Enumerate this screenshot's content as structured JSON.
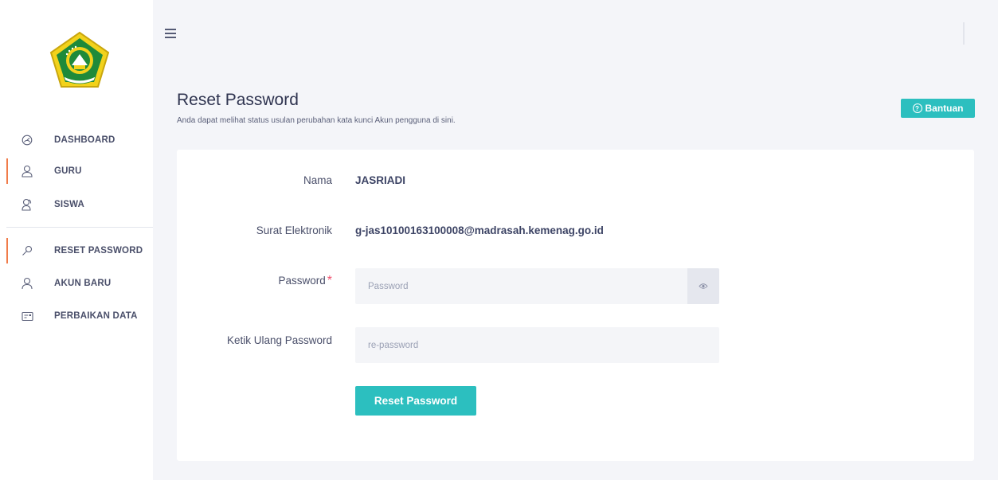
{
  "sidebar": {
    "logo_icon": "kemenag-emblem-icon",
    "items": [
      {
        "label": "DASHBOARD",
        "icon": "dashboard-gauge-icon",
        "active": false
      },
      {
        "label": "GURU",
        "icon": "user-icon",
        "active": true
      },
      {
        "label": "SISWA",
        "icon": "users-icon",
        "active": false
      },
      {
        "label": "RESET PASSWORD",
        "icon": "key-icon",
        "active": true
      },
      {
        "label": "AKUN BARU",
        "icon": "user-add-icon",
        "active": false
      },
      {
        "label": "PERBAIKAN DATA",
        "icon": "card-edit-icon",
        "active": false
      }
    ],
    "accent_color": "#f07c4a"
  },
  "header": {
    "menu_icon": "hamburger-icon"
  },
  "page": {
    "title": "Reset Password",
    "subtitle": "Anda dapat melihat status usulan perubahan kata kunci Akun pengguna di sini.",
    "help_label": "Bantuan",
    "help_icon": "question-circle-icon"
  },
  "form": {
    "name_label": "Nama",
    "name_value": "JASRIADI",
    "email_label": "Surat Elektronik",
    "email_value": "g-jas10100163100008@madrasah.kemenag.go.id",
    "password_label": "Password",
    "required_mark": "*",
    "password_placeholder": "Password",
    "password_value": "",
    "toggle_icon": "eye-icon",
    "repassword_label": "Ketik Ulang Password",
    "repassword_placeholder": "re-password",
    "repassword_value": "",
    "submit_label": "Reset Password"
  },
  "colors": {
    "primary": "#2cbfbf",
    "required": "#f0506e",
    "background": "#f4f5f9"
  }
}
